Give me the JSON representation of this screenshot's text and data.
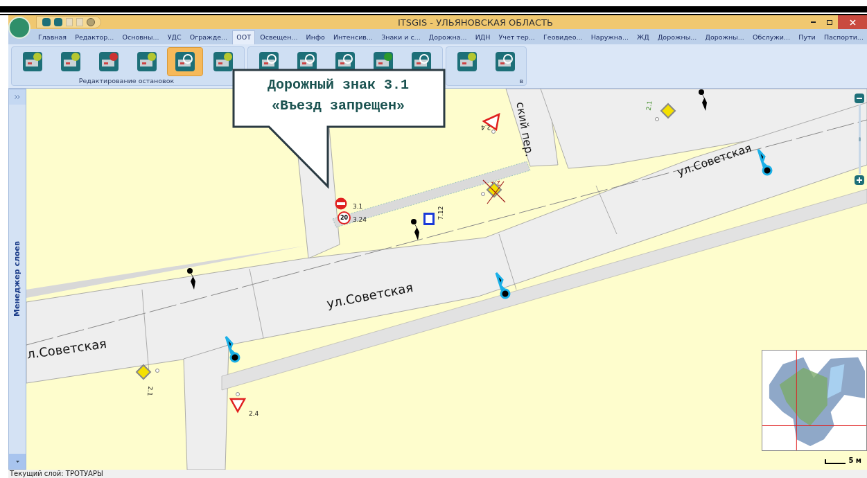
{
  "window": {
    "title": "ITSGIS - УЛЬЯНОВСКАЯ ОБЛАСТЬ"
  },
  "tabs": [
    {
      "label": "Главная",
      "selected": false
    },
    {
      "label": "Редактор...",
      "selected": false
    },
    {
      "label": "Основны...",
      "selected": false
    },
    {
      "label": "УДС",
      "selected": false
    },
    {
      "label": "Огражде...",
      "selected": false
    },
    {
      "label": "ООТ",
      "selected": true
    },
    {
      "label": "Освещен...",
      "selected": false
    },
    {
      "label": "Инфо",
      "selected": false
    },
    {
      "label": "Интенсив...",
      "selected": false
    },
    {
      "label": "Знаки и с...",
      "selected": false
    },
    {
      "label": "Дорожна...",
      "selected": false
    },
    {
      "label": "ИДН",
      "selected": false
    },
    {
      "label": "Учет тер...",
      "selected": false
    },
    {
      "label": "Геовидео...",
      "selected": false
    },
    {
      "label": "Наружна...",
      "selected": false
    },
    {
      "label": "ЖД",
      "selected": false
    },
    {
      "label": "Дорожны...",
      "selected": false
    },
    {
      "label": "Дорожны...",
      "selected": false
    },
    {
      "label": "Обслужи...",
      "selected": false
    },
    {
      "label": "Пути",
      "selected": false
    },
    {
      "label": "Паспорти...",
      "selected": false
    }
  ],
  "ribbon": {
    "groups": [
      {
        "label": "Редактирование остановок",
        "buttons": [
          {
            "selected": false
          },
          {
            "selected": false
          },
          {
            "selected": false
          },
          {
            "selected": false
          },
          {
            "selected": true
          },
          {
            "selected": false
          }
        ]
      },
      {
        "buttons": [
          {
            "selected": false
          },
          {
            "selected": false
          },
          {
            "selected": false
          },
          {
            "selected": false
          },
          {
            "selected": false
          }
        ]
      },
      {
        "label": "в",
        "buttons": [
          {
            "selected": false
          },
          {
            "selected": false
          }
        ]
      }
    ]
  },
  "layer_panel": {
    "title": "Менеджер слоев"
  },
  "callout": {
    "lines": [
      "Дорожный знак 3.1",
      "«Въезд запрещен»"
    ]
  },
  "map": {
    "streets": [
      "ул.Советская",
      "л.Советская",
      "ул.Советская",
      "ский пер."
    ],
    "sign_labels": [
      "3.1",
      "3.24",
      "7.12",
      "2.1",
      "2.4",
      "2.1",
      "2.1",
      "2.4"
    ],
    "speed_limit": "20",
    "scale": "5 м"
  },
  "status_bar": {
    "text": "Текущий слой: ТРОТУАРЫ"
  }
}
